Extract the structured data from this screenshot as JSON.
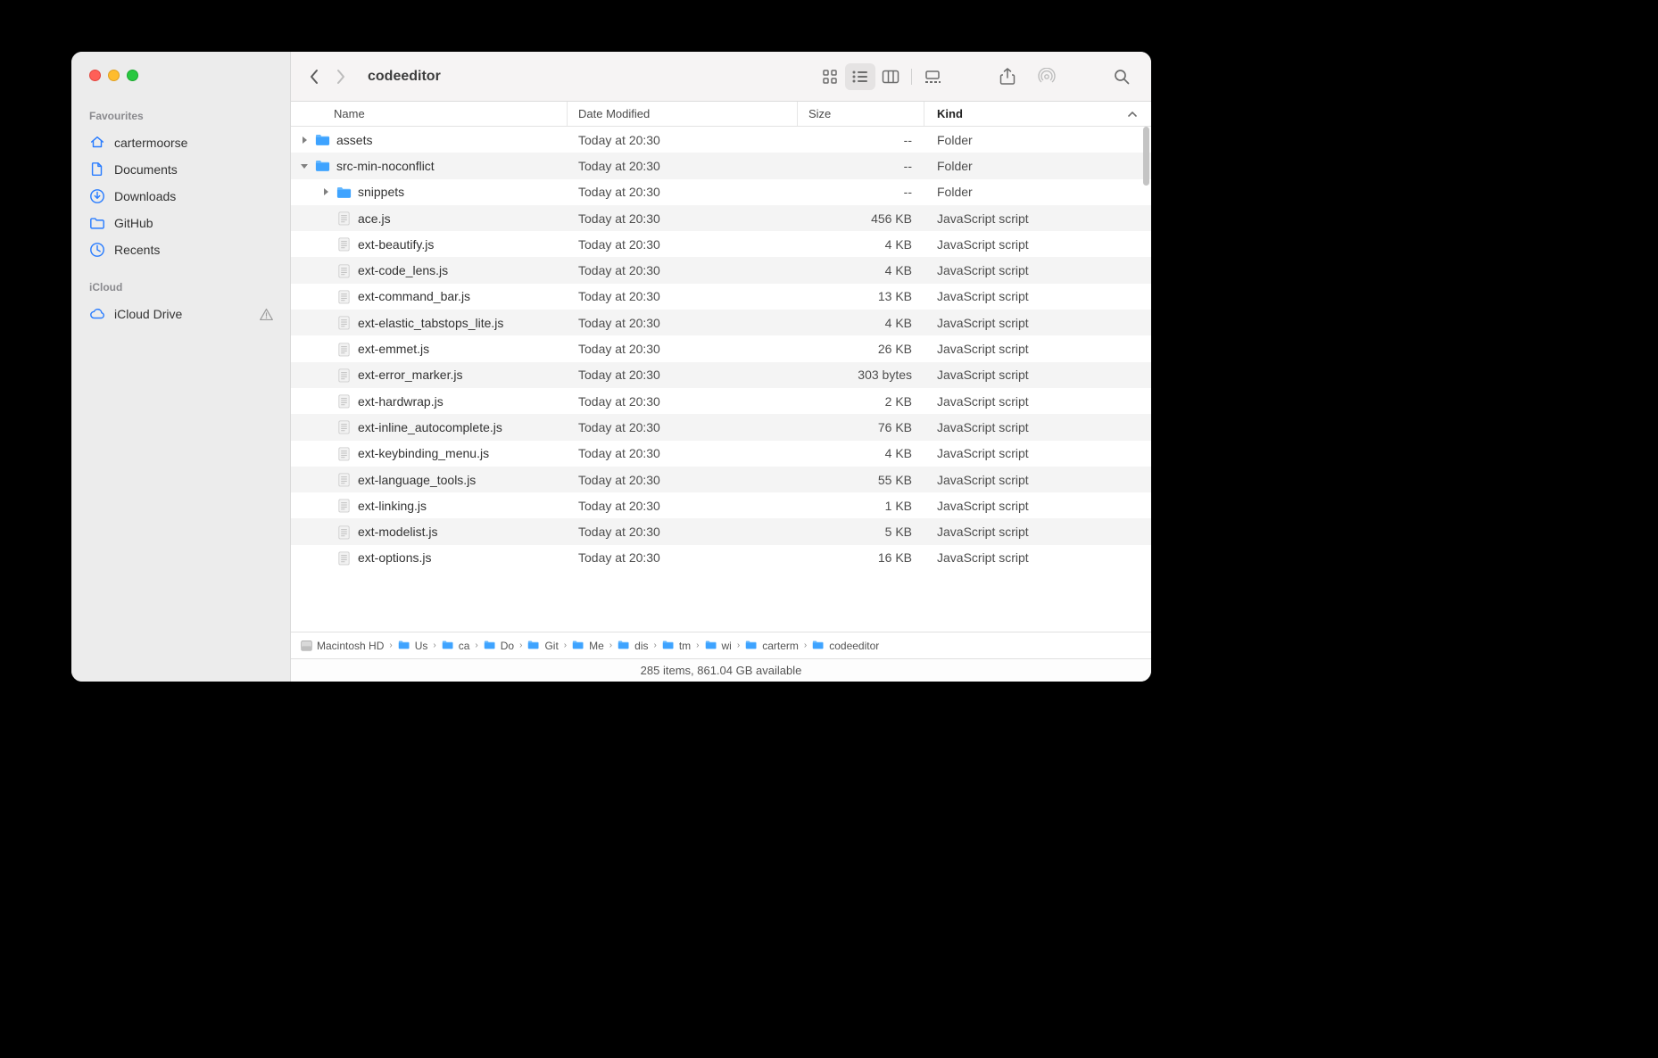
{
  "window": {
    "title": "codeeditor"
  },
  "sidebar": {
    "sections": [
      {
        "title": "Favourites",
        "items": [
          {
            "icon": "home-icon",
            "label": "cartermoorse"
          },
          {
            "icon": "document-icon",
            "label": "Documents"
          },
          {
            "icon": "download-icon",
            "label": "Downloads"
          },
          {
            "icon": "folder-icon",
            "label": "GitHub"
          },
          {
            "icon": "recents-icon",
            "label": "Recents"
          }
        ]
      },
      {
        "title": "iCloud",
        "items": [
          {
            "icon": "cloud-icon",
            "label": "iCloud Drive",
            "warning": true
          }
        ]
      }
    ]
  },
  "columns": {
    "name": "Name",
    "date": "Date Modified",
    "size": "Size",
    "kind": "Kind"
  },
  "sort_column": "Kind",
  "rows": [
    {
      "indent": 0,
      "disclosure": "closed",
      "icon": "folder",
      "name": "assets",
      "date": "Today at 20:30",
      "size": "--",
      "kind": "Folder"
    },
    {
      "indent": 0,
      "disclosure": "open",
      "icon": "folder",
      "name": "src-min-noconflict",
      "date": "Today at 20:30",
      "size": "--",
      "kind": "Folder"
    },
    {
      "indent": 1,
      "disclosure": "closed",
      "icon": "folder",
      "name": "snippets",
      "date": "Today at 20:30",
      "size": "--",
      "kind": "Folder"
    },
    {
      "indent": 1,
      "disclosure": "none",
      "icon": "file",
      "name": "ace.js",
      "date": "Today at 20:30",
      "size": "456 KB",
      "kind": "JavaScript script"
    },
    {
      "indent": 1,
      "disclosure": "none",
      "icon": "file",
      "name": "ext-beautify.js",
      "date": "Today at 20:30",
      "size": "4 KB",
      "kind": "JavaScript script"
    },
    {
      "indent": 1,
      "disclosure": "none",
      "icon": "file",
      "name": "ext-code_lens.js",
      "date": "Today at 20:30",
      "size": "4 KB",
      "kind": "JavaScript script"
    },
    {
      "indent": 1,
      "disclosure": "none",
      "icon": "file",
      "name": "ext-command_bar.js",
      "date": "Today at 20:30",
      "size": "13 KB",
      "kind": "JavaScript script"
    },
    {
      "indent": 1,
      "disclosure": "none",
      "icon": "file",
      "name": "ext-elastic_tabstops_lite.js",
      "date": "Today at 20:30",
      "size": "4 KB",
      "kind": "JavaScript script"
    },
    {
      "indent": 1,
      "disclosure": "none",
      "icon": "file",
      "name": "ext-emmet.js",
      "date": "Today at 20:30",
      "size": "26 KB",
      "kind": "JavaScript script"
    },
    {
      "indent": 1,
      "disclosure": "none",
      "icon": "file",
      "name": "ext-error_marker.js",
      "date": "Today at 20:30",
      "size": "303 bytes",
      "kind": "JavaScript script"
    },
    {
      "indent": 1,
      "disclosure": "none",
      "icon": "file",
      "name": "ext-hardwrap.js",
      "date": "Today at 20:30",
      "size": "2 KB",
      "kind": "JavaScript script"
    },
    {
      "indent": 1,
      "disclosure": "none",
      "icon": "file",
      "name": "ext-inline_autocomplete.js",
      "date": "Today at 20:30",
      "size": "76 KB",
      "kind": "JavaScript script"
    },
    {
      "indent": 1,
      "disclosure": "none",
      "icon": "file",
      "name": "ext-keybinding_menu.js",
      "date": "Today at 20:30",
      "size": "4 KB",
      "kind": "JavaScript script"
    },
    {
      "indent": 1,
      "disclosure": "none",
      "icon": "file",
      "name": "ext-language_tools.js",
      "date": "Today at 20:30",
      "size": "55 KB",
      "kind": "JavaScript script"
    },
    {
      "indent": 1,
      "disclosure": "none",
      "icon": "file",
      "name": "ext-linking.js",
      "date": "Today at 20:30",
      "size": "1 KB",
      "kind": "JavaScript script"
    },
    {
      "indent": 1,
      "disclosure": "none",
      "icon": "file",
      "name": "ext-modelist.js",
      "date": "Today at 20:30",
      "size": "5 KB",
      "kind": "JavaScript script"
    },
    {
      "indent": 1,
      "disclosure": "none",
      "icon": "file",
      "name": "ext-options.js",
      "date": "Today at 20:30",
      "size": "16 KB",
      "kind": "JavaScript script"
    }
  ],
  "path": [
    {
      "icon": "disk",
      "label": "Macintosh HD"
    },
    {
      "icon": "folder-tint",
      "label": "Us"
    },
    {
      "icon": "folder-tint",
      "label": "ca"
    },
    {
      "icon": "folder-tint",
      "label": "Do"
    },
    {
      "icon": "folder-tint",
      "label": "Git"
    },
    {
      "icon": "folder-tint",
      "label": "Me"
    },
    {
      "icon": "folder-tint",
      "label": "dis"
    },
    {
      "icon": "folder-tint",
      "label": "tm"
    },
    {
      "icon": "folder-tint",
      "label": "wi"
    },
    {
      "icon": "folder-tint",
      "label": "carterm"
    },
    {
      "icon": "folder-tint",
      "label": "codeeditor"
    }
  ],
  "status": "285 items, 861.04 GB available"
}
